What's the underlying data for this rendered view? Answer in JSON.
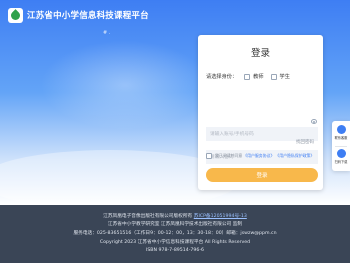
{
  "header": {
    "site_title": "江苏省中小学信息科技课程平台",
    "deco": "# ."
  },
  "login": {
    "title": "登录",
    "identity_label": "请选择身份：",
    "roles": [
      "教师",
      "学生"
    ],
    "account_placeholder": "请输入账号/手机号码",
    "password_placeholder": "请输入密码",
    "forgot_label": "找回密码",
    "agree_prefix": "我已阅读并同意",
    "user_agreement": "《用户服务协议》",
    "privacy_policy": "《用户隐私保护政策》",
    "submit_label": "登录"
  },
  "side": {
    "items": [
      {
        "label": "联系客服",
        "icon": "headset-icon"
      },
      {
        "label": "扫码下载",
        "icon": "qrcode-icon"
      }
    ]
  },
  "footer": {
    "line1_text": "江苏凤凰电子音像出版社有限公司版权所有",
    "line1_link": "苏ICP备12051994号-13",
    "line2": "江苏省中小学教学研究室 江苏凤凰科学技术出版社有限公司 监制",
    "line3": "服务电话：025-83651516（工作日9：00-12：00，13：30-18：00）邮箱：jswzw@ppm.cn",
    "line4": "Copyright 2023 江苏省中小学信息科技课程平台 All Rights Reserved",
    "line5": "ISBN 978-7-89514-796-6"
  },
  "colors": {
    "brand_blue": "#3e7ef3",
    "login_button": "#f8b84b",
    "footer_bg": "#3a4556"
  }
}
